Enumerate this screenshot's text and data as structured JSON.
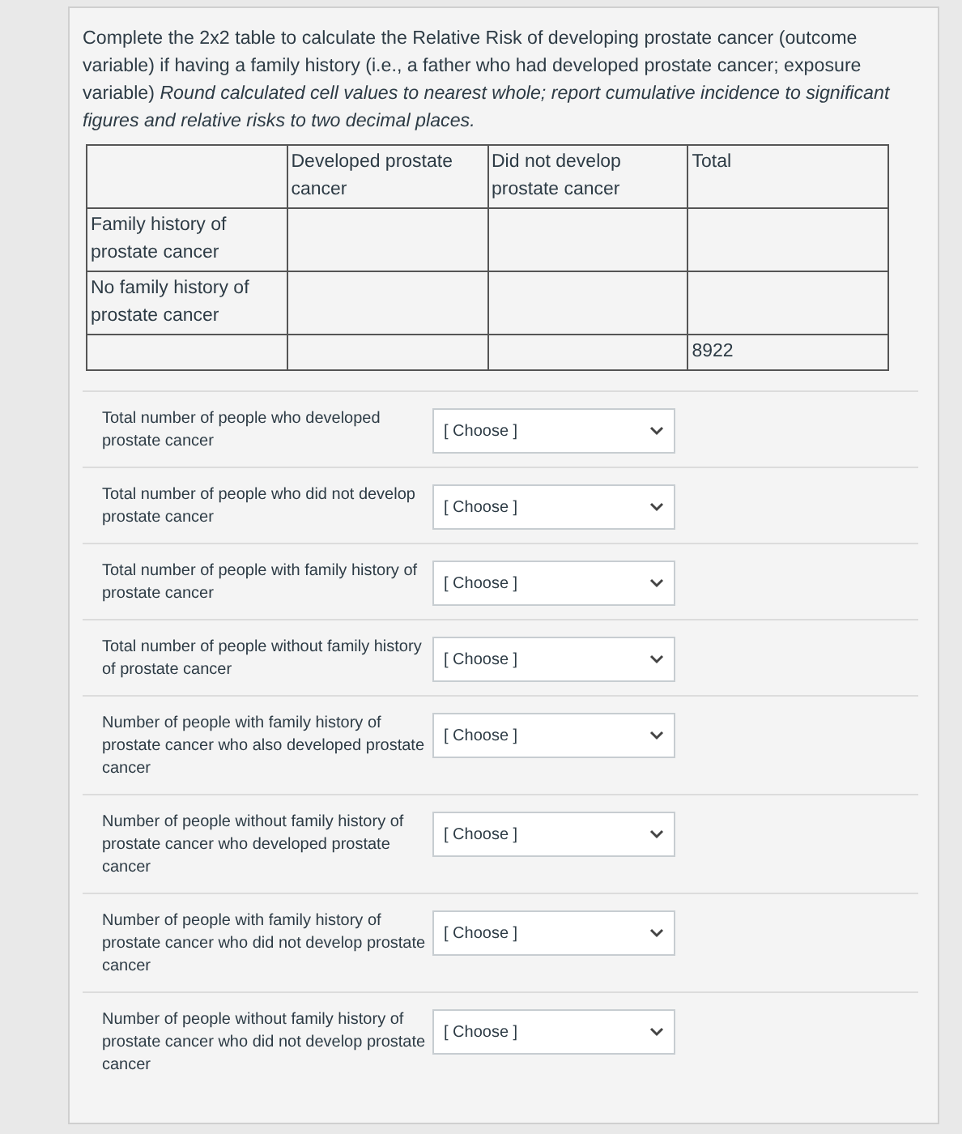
{
  "question": {
    "text": "Complete the 2x2 table to calculate the Relative Risk of developing prostate cancer (outcome variable) if having a family history (i.e., a father who had developed prostate cancer; exposure variable) *Round calculated cell values to nearest whole; report cumulative incidence to significant figures and relative risks to two decimal places.*"
  },
  "table": {
    "columns": [
      "",
      "Developed prostate cancer",
      "Did not develop prostate cancer",
      "Total"
    ],
    "rows": [
      [
        "Family history of prostate cancer",
        "",
        "",
        ""
      ],
      [
        "No family history of prostate cancer",
        "",
        "",
        ""
      ],
      [
        "",
        "",
        "",
        "8922"
      ]
    ]
  },
  "answers": [
    {
      "label": "Total number of people who developed prostate cancer",
      "placeholder": "[ Choose ]"
    },
    {
      "label": "Total number of people who did not develop prostate cancer",
      "placeholder": "[ Choose ]"
    },
    {
      "label": "Total number of people with family history of prostate cancer",
      "placeholder": "[ Choose ]"
    },
    {
      "label": "Total number of people without family history of prostate cancer",
      "placeholder": "[ Choose ]"
    },
    {
      "label": "Number of people with family history of prostate cancer who also developed prostate cancer",
      "placeholder": "[ Choose ]"
    },
    {
      "label": "Number of people without family history of prostate cancer who developed prostate cancer",
      "placeholder": "[ Choose ]"
    },
    {
      "label": "Number of people with family history of prostate cancer who did not develop prostate cancer",
      "placeholder": "[ Choose ]"
    },
    {
      "label": "Number of people without family history of prostate cancer who did not develop prostate cancer",
      "placeholder": "[ Choose ]"
    }
  ]
}
